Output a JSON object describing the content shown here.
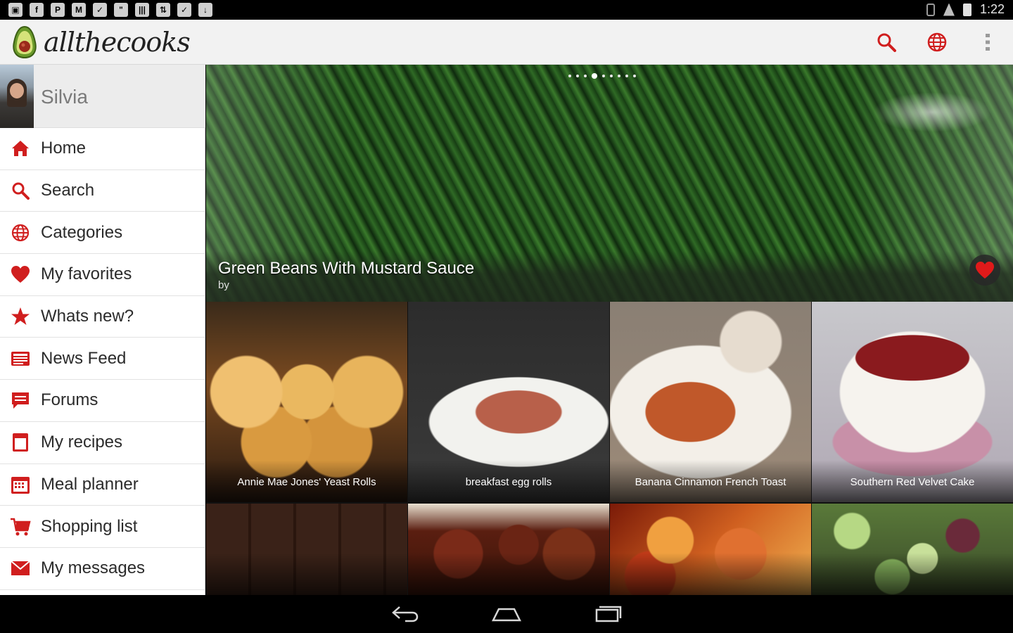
{
  "status_bar": {
    "time": "1:22",
    "left_icons": [
      "image-icon",
      "facebook-icon",
      "pinterest-icon",
      "gmail-icon",
      "shield-icon",
      "hangouts-icon",
      "barcode-icon",
      "sync-icon",
      "bag-icon",
      "download-icon"
    ]
  },
  "action_bar": {
    "app_name": "allthecooks",
    "actions": [
      "search-icon",
      "globe-icon",
      "overflow-menu-icon"
    ],
    "accent_color": "#d01e1e"
  },
  "drawer": {
    "user": {
      "name": "Silvia"
    },
    "items": [
      {
        "label": "Home",
        "icon": "home-icon"
      },
      {
        "label": "Search",
        "icon": "search-icon"
      },
      {
        "label": "Categories",
        "icon": "globe-icon"
      },
      {
        "label": "My favorites",
        "icon": "heart-icon"
      },
      {
        "label": "Whats new?",
        "icon": "star-icon"
      },
      {
        "label": "News Feed",
        "icon": "news-icon"
      },
      {
        "label": "Forums",
        "icon": "chat-icon"
      },
      {
        "label": "My recipes",
        "icon": "book-icon"
      },
      {
        "label": "Meal planner",
        "icon": "calendar-icon"
      },
      {
        "label": "Shopping list",
        "icon": "cart-icon"
      },
      {
        "label": "My messages",
        "icon": "mail-icon"
      }
    ]
  },
  "hero": {
    "title": "Green Beans With Mustard Sauce",
    "by": "by",
    "page_count": 9,
    "active_page": 4
  },
  "recipes": [
    {
      "title": "Annie Mae Jones' Yeast Rolls"
    },
    {
      "title": "breakfast egg rolls"
    },
    {
      "title": "Banana Cinnamon French Toast"
    },
    {
      "title": "Southern Red Velvet Cake"
    },
    {
      "title": ""
    },
    {
      "title": ""
    },
    {
      "title": ""
    },
    {
      "title": ""
    }
  ]
}
